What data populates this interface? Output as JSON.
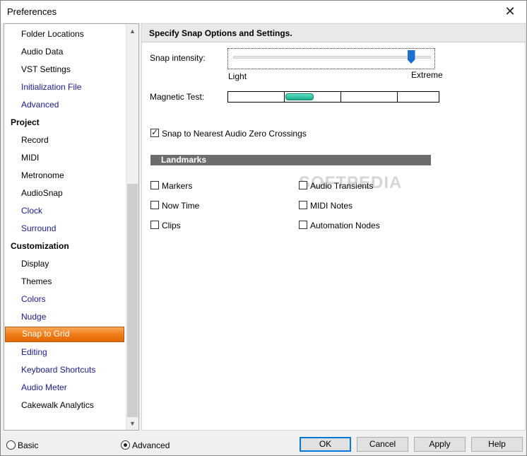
{
  "window": {
    "title": "Preferences"
  },
  "sidebar": {
    "items_top": [
      {
        "label": "Folder Locations",
        "color": "#000000"
      },
      {
        "label": "Audio Data",
        "color": "#000000"
      },
      {
        "label": "VST Settings",
        "color": "#000000"
      },
      {
        "label": "Initialization File",
        "color": "#1a1a8a"
      },
      {
        "label": "Advanced",
        "color": "#1a1a8a"
      }
    ],
    "group_project": "Project",
    "items_project": [
      {
        "label": "Record"
      },
      {
        "label": "MIDI"
      },
      {
        "label": "Metronome"
      },
      {
        "label": "AudioSnap"
      },
      {
        "label": "Clock"
      },
      {
        "label": "Surround"
      }
    ],
    "group_customization": "Customization",
    "items_customization": [
      {
        "label": "Display"
      },
      {
        "label": "Themes"
      },
      {
        "label": "Colors"
      },
      {
        "label": "Nudge"
      },
      {
        "label": "Snap to Grid"
      },
      {
        "label": "Editing"
      },
      {
        "label": "Keyboard Shortcuts"
      },
      {
        "label": "Audio Meter"
      },
      {
        "label": "Cakewalk Analytics"
      }
    ],
    "selected": "Snap to Grid"
  },
  "main": {
    "header": "Specify Snap Options and Settings.",
    "snap_intensity_label": "Snap intensity:",
    "slider_min_label": "Light",
    "slider_max_label": "Extreme",
    "slider_value_fraction": 0.9,
    "magnetic_test_label": "Magnetic Test:",
    "zero_crossing_label": "Snap to Nearest Audio Zero Crossings",
    "zero_crossing_checked": true,
    "landmarks_title": "Landmarks",
    "landmarks_left": [
      {
        "label": "Markers",
        "checked": false
      },
      {
        "label": "Now Time",
        "checked": false
      },
      {
        "label": "Clips",
        "checked": false
      }
    ],
    "landmarks_right": [
      {
        "label": "Audio Transients",
        "checked": false
      },
      {
        "label": "MIDI Notes",
        "checked": false
      },
      {
        "label": "Automation Nodes",
        "checked": false
      }
    ],
    "watermark": "SOFTPEDIA"
  },
  "footer": {
    "basic_label": "Basic",
    "advanced_label": "Advanced",
    "mode_selected": "Advanced",
    "ok_label": "OK",
    "cancel_label": "Cancel",
    "apply_label": "Apply",
    "help_label": "Help"
  },
  "colors": {
    "accent_selected": "#ef7a14",
    "slider_thumb": "#1a6fd0",
    "magnetic_pill": "#2cc5a4",
    "landmarks_bar": "#6d6d6d"
  }
}
